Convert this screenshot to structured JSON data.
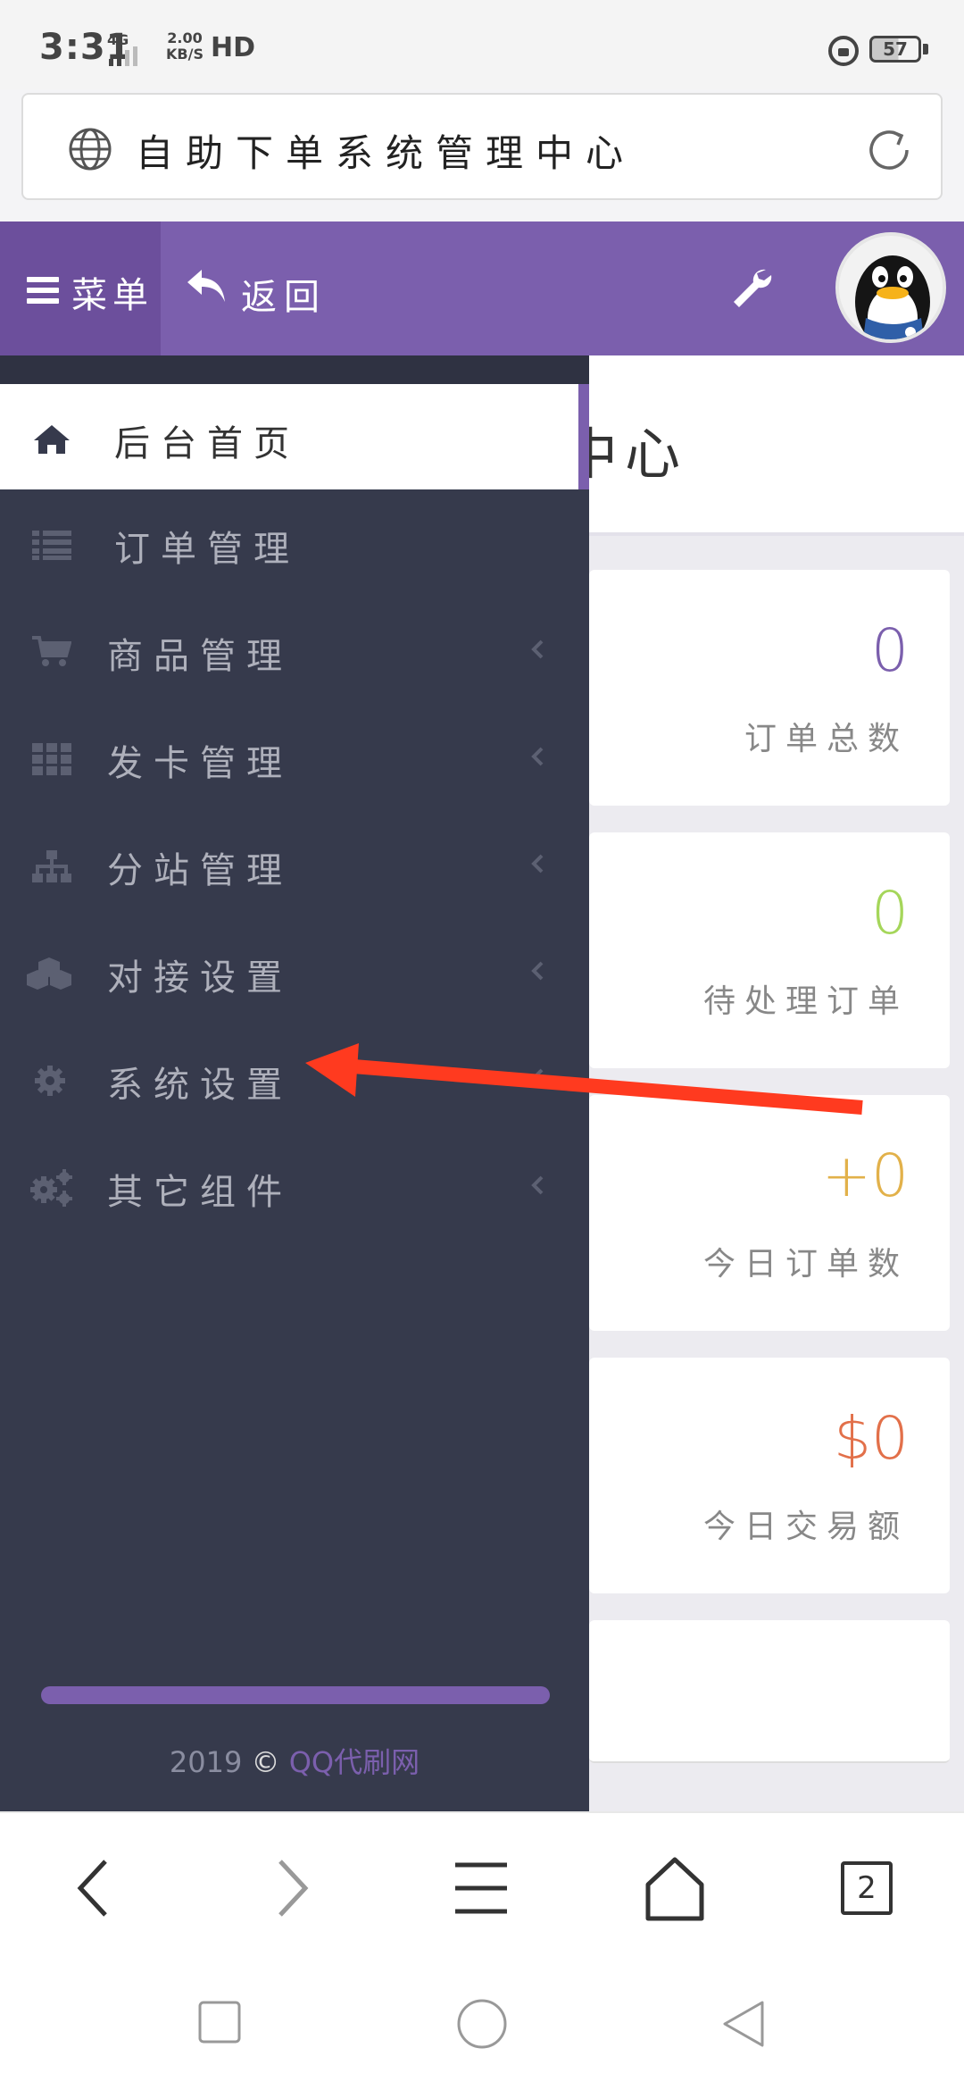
{
  "status_bar": {
    "time": "3:31",
    "network": "4G",
    "speed_value": "2.00",
    "speed_unit": "KB/S",
    "hd": "HD",
    "battery": "57"
  },
  "browser": {
    "page_title": "自助下单系统管理中心",
    "tab_count": "2"
  },
  "header": {
    "menu_label": "菜单",
    "back_label": "返回"
  },
  "content": {
    "heading_fragment": "中心",
    "stats": [
      {
        "value": "0",
        "label": "订单总数",
        "color": "#7b5fad"
      },
      {
        "value": "0",
        "label": "待处理订单",
        "color": "#a5d65a"
      },
      {
        "value": "+0",
        "label": "今日订单数",
        "color": "#e2b14a"
      },
      {
        "value": "$0",
        "label": "今日交易额",
        "color": "#e2704a"
      }
    ]
  },
  "sidebar": {
    "items": [
      {
        "label": "后台首页",
        "icon": "home-icon",
        "active": true
      },
      {
        "label": "订单管理",
        "icon": "list-icon"
      },
      {
        "label": "商品管理",
        "icon": "cart-icon",
        "has_submenu": true
      },
      {
        "label": "发卡管理",
        "icon": "grid-icon",
        "has_submenu": true
      },
      {
        "label": "分站管理",
        "icon": "sitemap-icon",
        "has_submenu": true
      },
      {
        "label": "对接设置",
        "icon": "cubes-icon",
        "has_submenu": true
      },
      {
        "label": "系统设置",
        "icon": "gear-icon",
        "has_submenu": true
      },
      {
        "label": "其它组件",
        "icon": "gears-icon",
        "has_submenu": true
      }
    ],
    "footer_year": "2019",
    "footer_copyright": "©",
    "footer_brand": "QQ代刷网"
  },
  "colors": {
    "accent": "#7b5fad",
    "sidebar_bg": "#363a4c",
    "annotation_arrow": "#ff3a1f"
  }
}
